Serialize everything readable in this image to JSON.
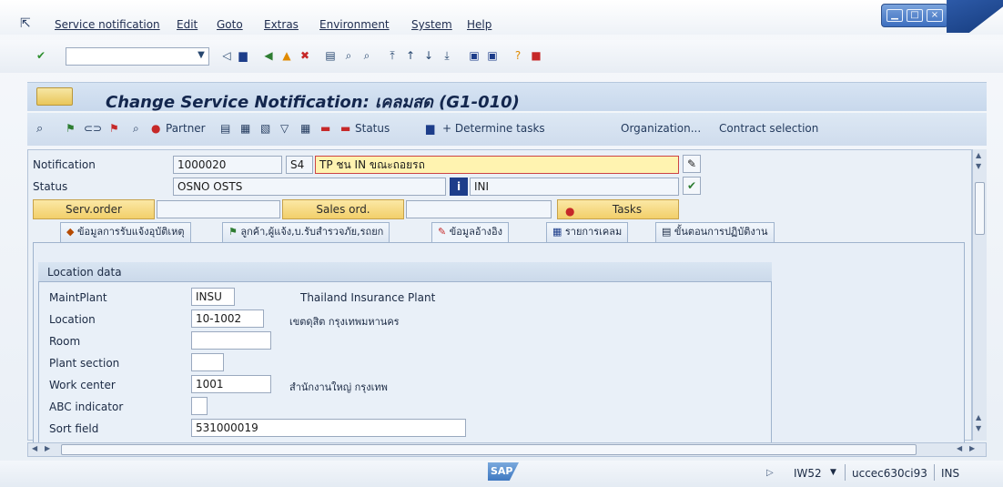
{
  "menu": [
    "Service notification",
    "Edit",
    "Goto",
    "Extras",
    "Environment",
    "System",
    "Help"
  ],
  "window": {
    "minimize": "▁",
    "maximize": "□",
    "close": "×"
  },
  "toolbar": {
    "command_field": ""
  },
  "title": "Change Service Notification: เคลมสด (G1-010)",
  "appbar": {
    "partner": "Partner",
    "status": "Status",
    "determine_tasks": "+ Determine tasks",
    "organization": "Organization...",
    "contract_selection": "Contract selection"
  },
  "header": {
    "notification_label": "Notification",
    "notification_value": "1000020",
    "notification_type": "S4",
    "description": "TP ชน IN ขณะถอยรถ",
    "status_label": "Status",
    "status_value": "OSNO OSTS",
    "status_info": "INI",
    "serv_order": "Serv.order",
    "sales_ord": "Sales ord.",
    "tasks": "Tasks"
  },
  "tabs": [
    "ข้อมูลการรับแจ้งอุบัติเหตุ",
    "ลูกค้า,ผู้แจ้ง,บ.รับสำรวจภัย,รถยก",
    "ข้อมูลอ้างอิง",
    "รายการเคลม",
    "ขั้นตอนการปฏิบัติงาน"
  ],
  "location": {
    "group_title": "Location data",
    "maintplant_label": "MaintPlant",
    "maintplant_value": "INSU",
    "maintplant_text": "Thailand Insurance Plant",
    "location_label": "Location",
    "location_value": "10-1002",
    "location_text": "เขตดุสิต กรุงเทพมหานคร",
    "room_label": "Room",
    "room_value": "",
    "plant_section_label": "Plant section",
    "plant_section_value": "",
    "work_center_label": "Work center",
    "work_center_value": "1001",
    "work_center_text": "สำนักงานใหญ่ กรุงเทพ",
    "abc_label": "ABC indicator",
    "abc_value": "",
    "sort_field_label": "Sort field",
    "sort_field_value": "531000019"
  },
  "status_bar": {
    "logo": "SAP",
    "transaction": "IW52",
    "server": "uccec630ci93",
    "mode": "INS"
  },
  "colors": {
    "title": "#13264d",
    "button": "#f2cf6a",
    "active_field": "#fff3b0"
  }
}
